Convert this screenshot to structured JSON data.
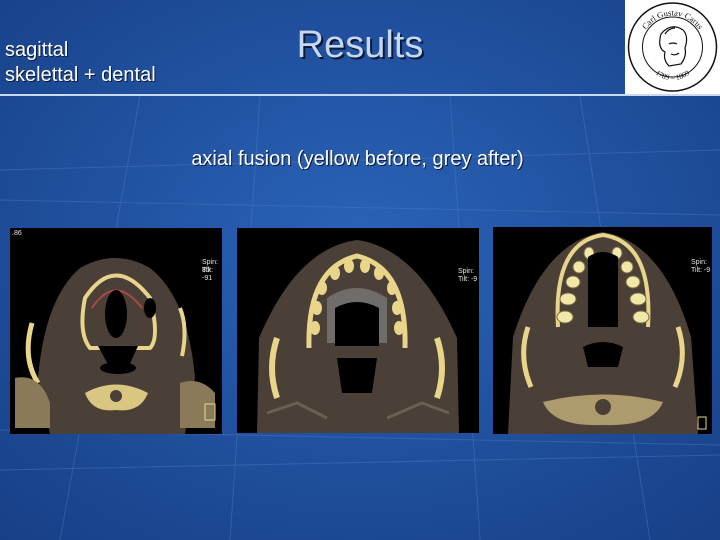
{
  "slide": {
    "title": "Results",
    "side_lines": [
      "sagittal",
      "skelettal + dental"
    ],
    "caption": "axial fusion (yellow before, grey after)"
  },
  "logo": {
    "text_top": "Carl Gustav Carus",
    "text_bottom": "1789 – 1869"
  },
  "scans": [
    {
      "corner": ".86",
      "spin": "Spin: 85",
      "tilt": "Tilt: -91"
    },
    {
      "corner": "",
      "spin": "Spin:",
      "tilt": "Tilt: -9"
    },
    {
      "corner": "",
      "spin": "Spin:",
      "tilt": "Tilt: -9"
    }
  ],
  "colors": {
    "background": "#1f54a6",
    "bone_yellow": "#e8d58a",
    "soft_tissue": "#4a4038"
  }
}
